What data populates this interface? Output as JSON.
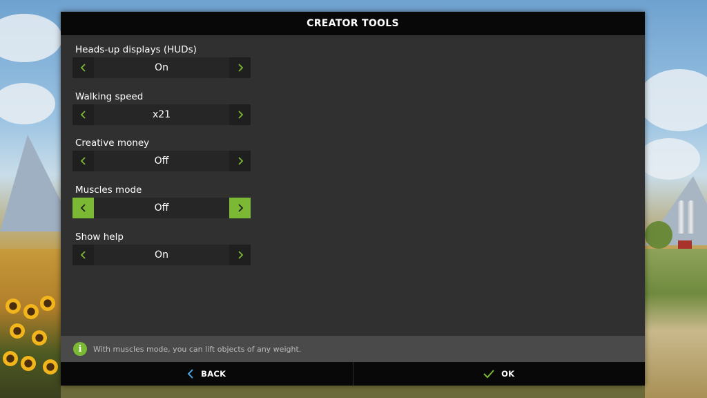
{
  "dialog": {
    "title": "CREATOR TOOLS"
  },
  "settings": [
    {
      "label": "Heads-up displays (HUDs)",
      "value": "On"
    },
    {
      "label": "Walking speed",
      "value": "x21"
    },
    {
      "label": "Creative money",
      "value": "Off"
    },
    {
      "label": "Muscles mode",
      "value": "Off",
      "selected": true
    },
    {
      "label": "Show help",
      "value": "On"
    }
  ],
  "help": {
    "icon": "info-icon",
    "icon_glyph": "i",
    "text": "With muscles mode, you can lift objects of any weight."
  },
  "footer": {
    "back_label": "BACK",
    "ok_label": "OK",
    "back_icon": "chevron-left-icon",
    "ok_icon": "checkmark-icon"
  },
  "colors": {
    "accent": "#7bb934",
    "back_icon": "#4aa3df",
    "panel": "#303030",
    "header": "#080808"
  }
}
